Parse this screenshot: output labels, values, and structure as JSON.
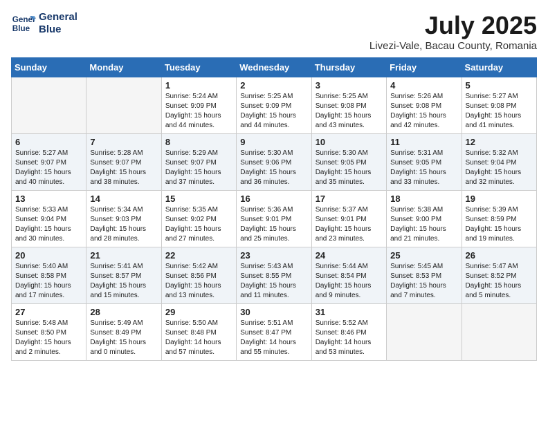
{
  "logo": {
    "line1": "General",
    "line2": "Blue"
  },
  "title": "July 2025",
  "location": "Livezi-Vale, Bacau County, Romania",
  "headers": [
    "Sunday",
    "Monday",
    "Tuesday",
    "Wednesday",
    "Thursday",
    "Friday",
    "Saturday"
  ],
  "weeks": [
    [
      {
        "day": "",
        "info": ""
      },
      {
        "day": "",
        "info": ""
      },
      {
        "day": "1",
        "info": "Sunrise: 5:24 AM\nSunset: 9:09 PM\nDaylight: 15 hours\nand 44 minutes."
      },
      {
        "day": "2",
        "info": "Sunrise: 5:25 AM\nSunset: 9:09 PM\nDaylight: 15 hours\nand 44 minutes."
      },
      {
        "day": "3",
        "info": "Sunrise: 5:25 AM\nSunset: 9:08 PM\nDaylight: 15 hours\nand 43 minutes."
      },
      {
        "day": "4",
        "info": "Sunrise: 5:26 AM\nSunset: 9:08 PM\nDaylight: 15 hours\nand 42 minutes."
      },
      {
        "day": "5",
        "info": "Sunrise: 5:27 AM\nSunset: 9:08 PM\nDaylight: 15 hours\nand 41 minutes."
      }
    ],
    [
      {
        "day": "6",
        "info": "Sunrise: 5:27 AM\nSunset: 9:07 PM\nDaylight: 15 hours\nand 40 minutes."
      },
      {
        "day": "7",
        "info": "Sunrise: 5:28 AM\nSunset: 9:07 PM\nDaylight: 15 hours\nand 38 minutes."
      },
      {
        "day": "8",
        "info": "Sunrise: 5:29 AM\nSunset: 9:07 PM\nDaylight: 15 hours\nand 37 minutes."
      },
      {
        "day": "9",
        "info": "Sunrise: 5:30 AM\nSunset: 9:06 PM\nDaylight: 15 hours\nand 36 minutes."
      },
      {
        "day": "10",
        "info": "Sunrise: 5:30 AM\nSunset: 9:05 PM\nDaylight: 15 hours\nand 35 minutes."
      },
      {
        "day": "11",
        "info": "Sunrise: 5:31 AM\nSunset: 9:05 PM\nDaylight: 15 hours\nand 33 minutes."
      },
      {
        "day": "12",
        "info": "Sunrise: 5:32 AM\nSunset: 9:04 PM\nDaylight: 15 hours\nand 32 minutes."
      }
    ],
    [
      {
        "day": "13",
        "info": "Sunrise: 5:33 AM\nSunset: 9:04 PM\nDaylight: 15 hours\nand 30 minutes."
      },
      {
        "day": "14",
        "info": "Sunrise: 5:34 AM\nSunset: 9:03 PM\nDaylight: 15 hours\nand 28 minutes."
      },
      {
        "day": "15",
        "info": "Sunrise: 5:35 AM\nSunset: 9:02 PM\nDaylight: 15 hours\nand 27 minutes."
      },
      {
        "day": "16",
        "info": "Sunrise: 5:36 AM\nSunset: 9:01 PM\nDaylight: 15 hours\nand 25 minutes."
      },
      {
        "day": "17",
        "info": "Sunrise: 5:37 AM\nSunset: 9:01 PM\nDaylight: 15 hours\nand 23 minutes."
      },
      {
        "day": "18",
        "info": "Sunrise: 5:38 AM\nSunset: 9:00 PM\nDaylight: 15 hours\nand 21 minutes."
      },
      {
        "day": "19",
        "info": "Sunrise: 5:39 AM\nSunset: 8:59 PM\nDaylight: 15 hours\nand 19 minutes."
      }
    ],
    [
      {
        "day": "20",
        "info": "Sunrise: 5:40 AM\nSunset: 8:58 PM\nDaylight: 15 hours\nand 17 minutes."
      },
      {
        "day": "21",
        "info": "Sunrise: 5:41 AM\nSunset: 8:57 PM\nDaylight: 15 hours\nand 15 minutes."
      },
      {
        "day": "22",
        "info": "Sunrise: 5:42 AM\nSunset: 8:56 PM\nDaylight: 15 hours\nand 13 minutes."
      },
      {
        "day": "23",
        "info": "Sunrise: 5:43 AM\nSunset: 8:55 PM\nDaylight: 15 hours\nand 11 minutes."
      },
      {
        "day": "24",
        "info": "Sunrise: 5:44 AM\nSunset: 8:54 PM\nDaylight: 15 hours\nand 9 minutes."
      },
      {
        "day": "25",
        "info": "Sunrise: 5:45 AM\nSunset: 8:53 PM\nDaylight: 15 hours\nand 7 minutes."
      },
      {
        "day": "26",
        "info": "Sunrise: 5:47 AM\nSunset: 8:52 PM\nDaylight: 15 hours\nand 5 minutes."
      }
    ],
    [
      {
        "day": "27",
        "info": "Sunrise: 5:48 AM\nSunset: 8:50 PM\nDaylight: 15 hours\nand 2 minutes."
      },
      {
        "day": "28",
        "info": "Sunrise: 5:49 AM\nSunset: 8:49 PM\nDaylight: 15 hours\nand 0 minutes."
      },
      {
        "day": "29",
        "info": "Sunrise: 5:50 AM\nSunset: 8:48 PM\nDaylight: 14 hours\nand 57 minutes."
      },
      {
        "day": "30",
        "info": "Sunrise: 5:51 AM\nSunset: 8:47 PM\nDaylight: 14 hours\nand 55 minutes."
      },
      {
        "day": "31",
        "info": "Sunrise: 5:52 AM\nSunset: 8:46 PM\nDaylight: 14 hours\nand 53 minutes."
      },
      {
        "day": "",
        "info": ""
      },
      {
        "day": "",
        "info": ""
      }
    ]
  ]
}
